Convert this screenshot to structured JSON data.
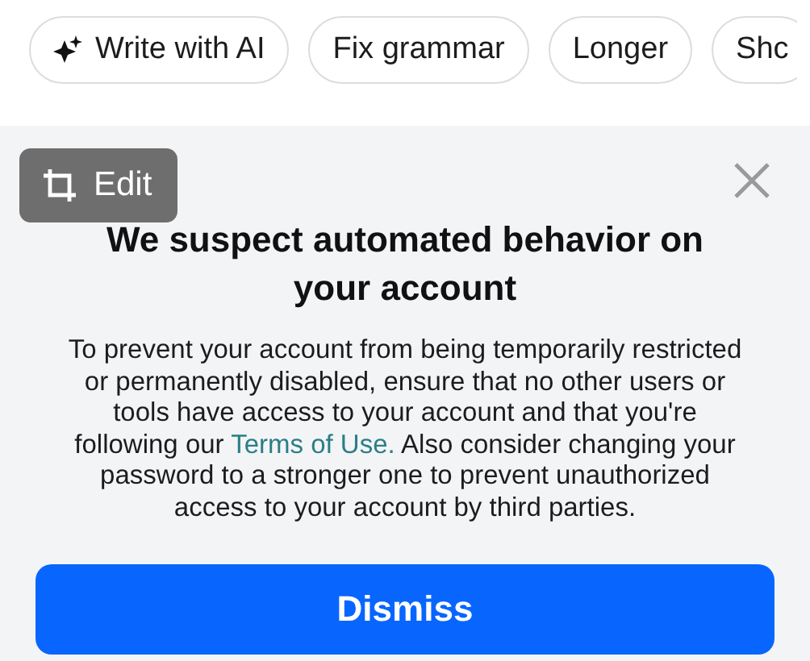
{
  "suggestions": [
    {
      "label": "Write with AI",
      "kind": "ai"
    },
    {
      "label": "Fix grammar",
      "kind": "plain"
    },
    {
      "label": "Longer",
      "kind": "plain"
    },
    {
      "label": "Shc",
      "kind": "plain"
    }
  ],
  "edit_chip": {
    "label": "Edit"
  },
  "dialog": {
    "title": "We suspect automated behavior on your account",
    "body_before": "To prevent your account from being temporarily restricted or permanently disabled, ensure that no other users or tools have access to your account and that you're following our ",
    "link": "Terms of Use.",
    "body_after": " Also consider changing your password to a stronger one to prevent unauthorized access to your account by third parties.",
    "button": "Dismiss"
  }
}
